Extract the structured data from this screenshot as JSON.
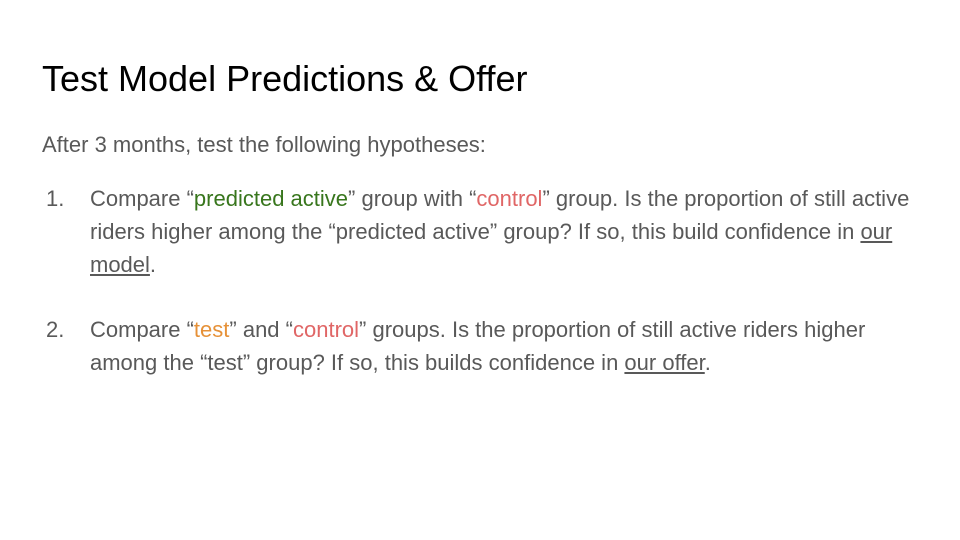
{
  "slide": {
    "title": "Test Model Predictions & Offer",
    "intro": "After 3 months, test the following hypotheses:",
    "colors": {
      "body_text": "#595959",
      "predicted_active": "#38761d",
      "control": "#e06666",
      "test": "#e69138"
    },
    "items": [
      {
        "number": "1.",
        "p1": "Compare “",
        "h1": "predicted active",
        "p2": "” group with “",
        "h2": "control",
        "p3": "” group.  Is the proportion of still active riders higher among the “predicted active” group?  If so, this build confidence in ",
        "link": "our model",
        "p4": "."
      },
      {
        "number": "2.",
        "p1": "Compare “",
        "h1": "test",
        "p2": "” and “",
        "h2": "control",
        "p3": "” groups.  Is the proportion of still active riders higher among the “test” group? If so, this builds confidence in ",
        "link": "our offer",
        "p4": "."
      }
    ]
  }
}
